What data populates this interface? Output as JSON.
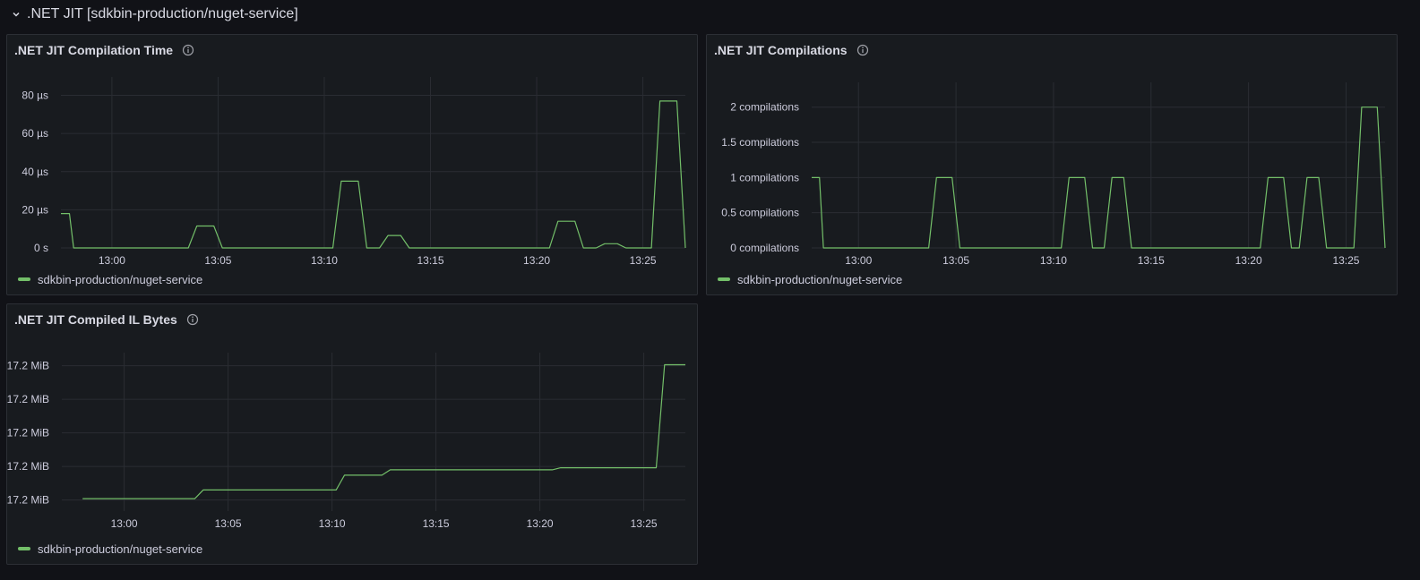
{
  "row": {
    "title": ".NET JIT [sdkbin-production/nuget-service]"
  },
  "colors": {
    "series": "#73bf69",
    "grid": "#2a2d33",
    "background": "#111217",
    "panel": "#181b1f"
  },
  "chart_data": [
    {
      "type": "line",
      "title": ".NET JIT Compilation Time",
      "xlabel": "",
      "ylabel": "",
      "y_unit": "µs",
      "x_ticks": [
        "13:00",
        "13:05",
        "13:10",
        "13:15",
        "13:20",
        "13:25"
      ],
      "x_range": [
        "12:57:36",
        "13:27:00"
      ],
      "y_ticks": [
        "0 s",
        "20 µs",
        "40 µs",
        "60 µs",
        "80 µs"
      ],
      "ylim": [
        0,
        84
      ],
      "legend": "bottom-left",
      "series": [
        {
          "name": "sdkbin-production/nuget-service",
          "x": [
            "12:57:36",
            "12:58:00",
            "12:58:12",
            "13:03:36",
            "13:04:00",
            "13:04:48",
            "13:05:12",
            "13:10:24",
            "13:10:48",
            "13:11:36",
            "13:12:00",
            "13:12:36",
            "13:13:00",
            "13:13:36",
            "13:14:00",
            "13:20:36",
            "13:21:00",
            "13:21:48",
            "13:22:12",
            "13:22:48",
            "13:23:12",
            "13:23:48",
            "13:24:12",
            "13:25:24",
            "13:25:48",
            "13:26:36",
            "13:27:00"
          ],
          "values": [
            18,
            18,
            0,
            0,
            11.5,
            11.5,
            0,
            0,
            35,
            35,
            0,
            0,
            6.5,
            6.5,
            0,
            0,
            14,
            14,
            0,
            0,
            2.2,
            2.2,
            0,
            0,
            77,
            77,
            0
          ]
        }
      ]
    },
    {
      "type": "line",
      "title": ".NET JIT Compilations",
      "xlabel": "",
      "ylabel": "",
      "y_unit": "compilations",
      "x_ticks": [
        "13:00",
        "13:05",
        "13:10",
        "13:15",
        "13:20",
        "13:25"
      ],
      "x_range": [
        "12:57:36",
        "13:27:00"
      ],
      "y_ticks": [
        "0 compilations",
        "0.5 compilations",
        "1 compilations",
        "1.5 compilations",
        "2 compilations"
      ],
      "ylim": [
        0,
        2.2
      ],
      "legend": "bottom-left",
      "series": [
        {
          "name": "sdkbin-production/nuget-service",
          "x": [
            "12:57:36",
            "12:58:00",
            "12:58:12",
            "13:03:36",
            "13:04:00",
            "13:04:48",
            "13:05:12",
            "13:10:24",
            "13:10:48",
            "13:11:36",
            "13:12:00",
            "13:12:36",
            "13:13:00",
            "13:13:36",
            "13:14:00",
            "13:20:36",
            "13:21:00",
            "13:21:48",
            "13:22:12",
            "13:22:36",
            "13:23:00",
            "13:23:36",
            "13:24:00",
            "13:25:24",
            "13:25:48",
            "13:26:36",
            "13:27:00"
          ],
          "values": [
            1,
            1,
            0,
            0,
            1,
            1,
            0,
            0,
            1,
            1,
            0,
            0,
            1,
            1,
            0,
            0,
            1,
            1,
            0,
            0,
            1,
            1,
            0,
            0,
            2,
            2,
            0
          ]
        }
      ]
    },
    {
      "type": "line",
      "title": ".NET JIT Compiled IL Bytes",
      "xlabel": "",
      "ylabel": "",
      "y_unit": "MiB",
      "x_ticks": [
        "13:00",
        "13:05",
        "13:10",
        "13:15",
        "13:20",
        "13:25"
      ],
      "x_range": [
        "12:57:00",
        "13:27:00"
      ],
      "y_ticks": [
        "17.2 MiB",
        "17.2 MiB",
        "17.2 MiB",
        "17.2 MiB",
        "17.2 MiB"
      ],
      "ylim": [
        0,
        4.4
      ],
      "legend": "bottom-left",
      "series": [
        {
          "name": "sdkbin-production/nuget-service",
          "x": [
            "12:58:00",
            "13:03:24",
            "13:03:48",
            "13:10:12",
            "13:10:36",
            "13:12:24",
            "13:12:48",
            "13:20:36",
            "13:21:00",
            "13:25:36",
            "13:26:00",
            "13:27:00"
          ],
          "values": [
            0.37,
            0.37,
            0.63,
            0.63,
            1.07,
            1.07,
            1.23,
            1.23,
            1.29,
            1.29,
            4.36,
            4.36
          ]
        }
      ]
    }
  ]
}
